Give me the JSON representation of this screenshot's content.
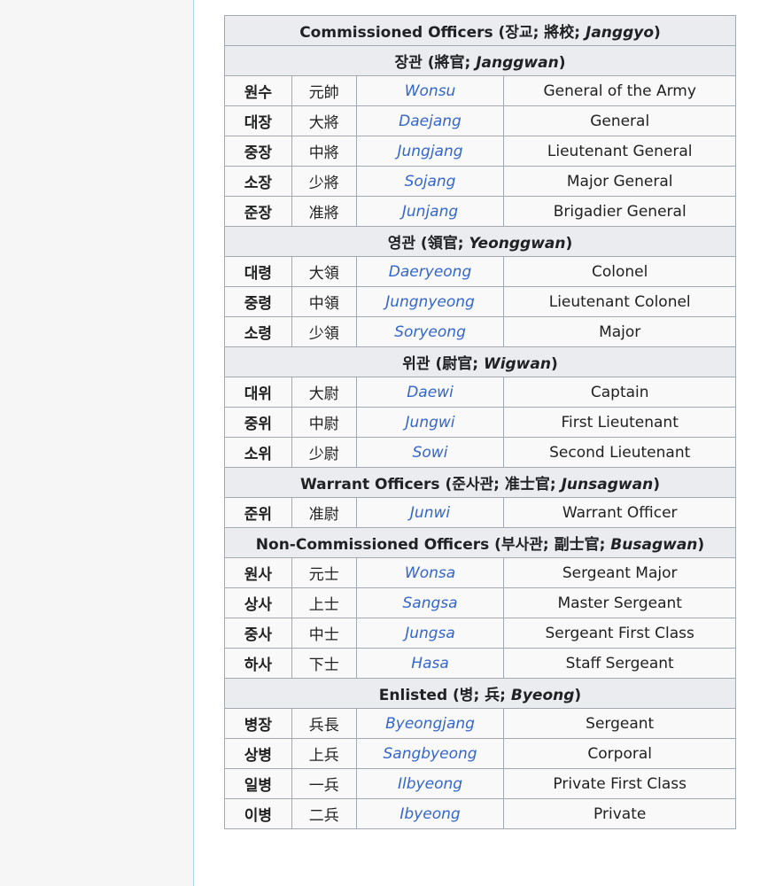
{
  "sections": [
    {
      "title": "Commissioned Officers (장교; 將校; ",
      "title_roman": "Janggyo",
      "title_end": ")",
      "rows": []
    },
    {
      "title": "장관 (將官; ",
      "title_roman": "Janggwan",
      "title_end": ")",
      "rows": [
        {
          "hangul": "원수",
          "hanja": "元帥",
          "roman": "Wonsu",
          "english": "General of the Army"
        },
        {
          "hangul": "대장",
          "hanja": "大將",
          "roman": "Daejang",
          "english": "General"
        },
        {
          "hangul": "중장",
          "hanja": "中將",
          "roman": "Jungjang",
          "english": "Lieutenant General"
        },
        {
          "hangul": "소장",
          "hanja": "少將",
          "roman": "Sojang",
          "english": "Major General"
        },
        {
          "hangul": "준장",
          "hanja": "准將",
          "roman": "Junjang",
          "english": "Brigadier General"
        }
      ]
    },
    {
      "title": "영관 (領官; ",
      "title_roman": "Yeonggwan",
      "title_end": ")",
      "rows": [
        {
          "hangul": "대령",
          "hanja": "大領",
          "roman": "Daeryeong",
          "english": "Colonel"
        },
        {
          "hangul": "중령",
          "hanja": "中領",
          "roman": "Jungnyeong",
          "english": "Lieutenant Colonel"
        },
        {
          "hangul": "소령",
          "hanja": "少領",
          "roman": "Soryeong",
          "english": "Major"
        }
      ]
    },
    {
      "title": "위관 (尉官; ",
      "title_roman": "Wigwan",
      "title_end": ")",
      "rows": [
        {
          "hangul": "대위",
          "hanja": "大尉",
          "roman": "Daewi",
          "english": "Captain"
        },
        {
          "hangul": "중위",
          "hanja": "中尉",
          "roman": "Jungwi",
          "english": "First Lieutenant"
        },
        {
          "hangul": "소위",
          "hanja": "少尉",
          "roman": "Sowi",
          "english": "Second Lieutenant"
        }
      ]
    },
    {
      "title": "Warrant Officers (준사관; 准士官; ",
      "title_roman": "Junsagwan",
      "title_end": ")",
      "rows": [
        {
          "hangul": "준위",
          "hanja": "准尉",
          "roman": "Junwi",
          "english": "Warrant Officer"
        }
      ]
    },
    {
      "title": "Non-Commissioned Officers (부사관; 副士官; ",
      "title_roman": "Busagwan",
      "title_end": ")",
      "rows": [
        {
          "hangul": "원사",
          "hanja": "元士",
          "roman": "Wonsa",
          "english": "Sergeant Major"
        },
        {
          "hangul": "상사",
          "hanja": "上士",
          "roman": "Sangsa",
          "english": "Master Sergeant"
        },
        {
          "hangul": "중사",
          "hanja": "中士",
          "roman": "Jungsa",
          "english": "Sergeant First Class"
        },
        {
          "hangul": "하사",
          "hanja": "下士",
          "roman": "Hasa",
          "english": "Staff Sergeant"
        }
      ]
    },
    {
      "title": "Enlisted (병; 兵; ",
      "title_roman": "Byeong",
      "title_end": ")",
      "rows": [
        {
          "hangul": "병장",
          "hanja": "兵長",
          "roman": "Byeongjang",
          "english": "Sergeant"
        },
        {
          "hangul": "상병",
          "hanja": "上兵",
          "roman": "Sangbyeong",
          "english": "Corporal"
        },
        {
          "hangul": "일병",
          "hanja": "一兵",
          "roman": "Ilbyeong",
          "english": "Private First Class"
        },
        {
          "hangul": "이병",
          "hanja": "二兵",
          "roman": "Ibyeong",
          "english": "Private"
        }
      ]
    }
  ]
}
